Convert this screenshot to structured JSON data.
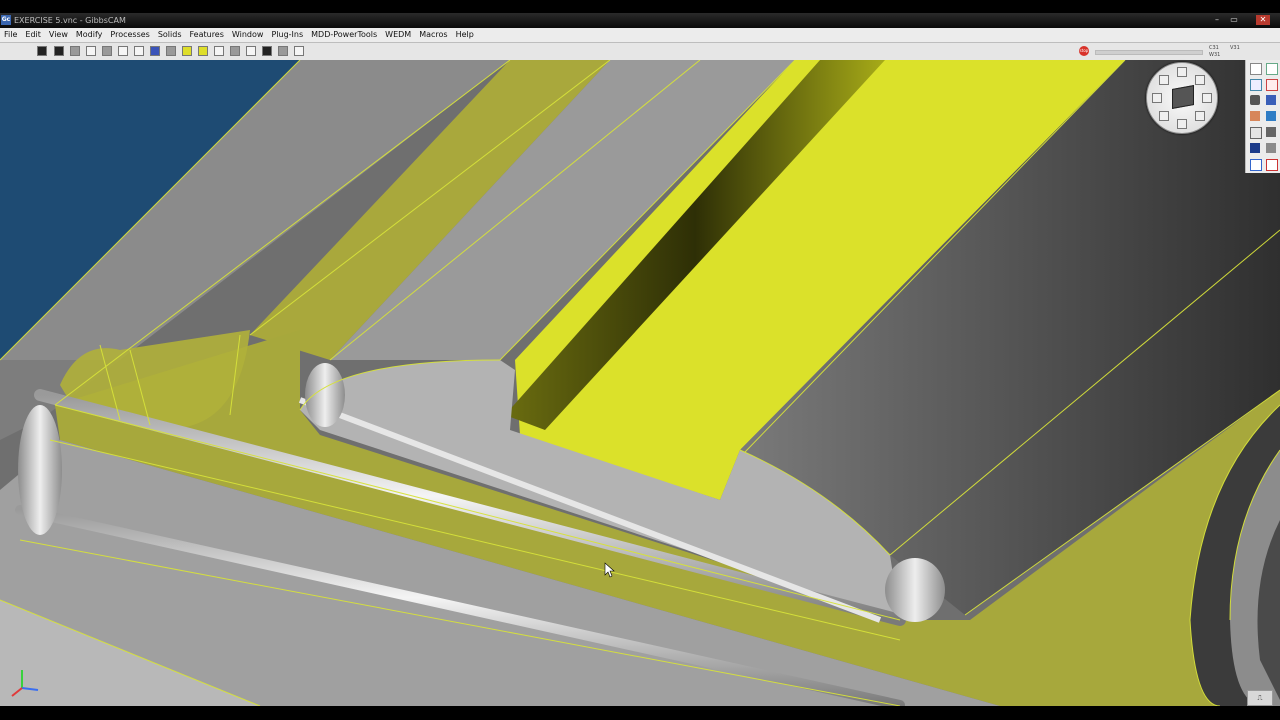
{
  "window": {
    "icon_text": "Gc",
    "title": "EXERCISE 5.vnc - GibbsCAM",
    "buttons": [
      "–",
      "▭",
      "✕"
    ]
  },
  "menu": {
    "items": [
      "File",
      "Edit",
      "View",
      "Modify",
      "Processes",
      "Solids",
      "Features",
      "Window",
      "Plug-Ins",
      "MDD-PowerTools",
      "WEDM",
      "Macros",
      "Help"
    ]
  },
  "toolbar": {
    "stop_label": "stop",
    "coord_top": "C31",
    "coord_bottom": "W31",
    "coord_top_right": "V31"
  },
  "icons": {
    "stop": "stop-sign-icon",
    "view_dial": "view-orientation-dial-icon",
    "axis": "xyz-axis-triad-icon",
    "cursor": "mouse-pointer-icon"
  },
  "colors": {
    "selected_face": "#dbe12a",
    "selected_face_shadow": "#a8a23a",
    "wire_edge": "#d7e23a",
    "background_blue": "#1d4a72",
    "part_grey": "#a9a9a9"
  },
  "corner_button_label": "⎍"
}
